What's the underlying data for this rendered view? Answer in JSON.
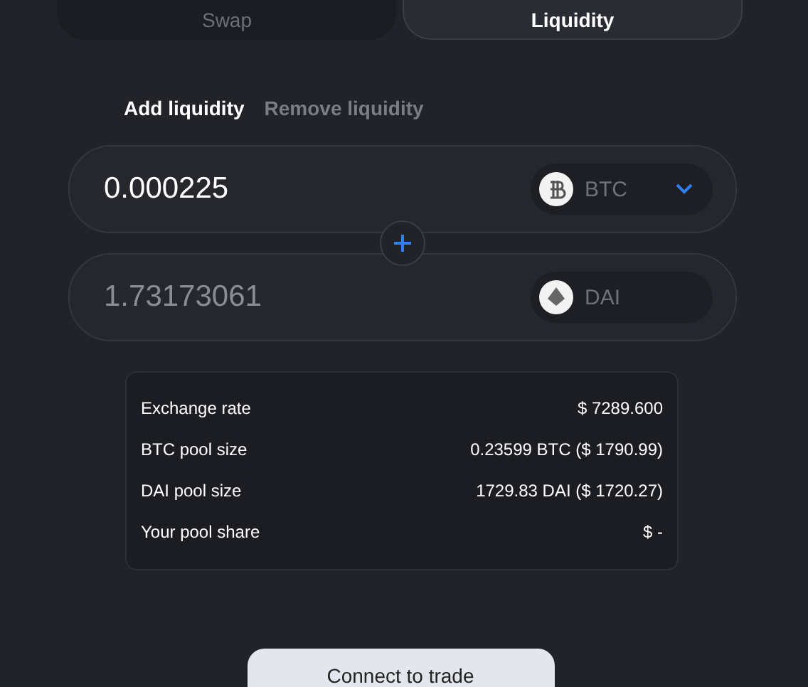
{
  "main_tabs": [
    {
      "label": "Swap",
      "selected": false
    },
    {
      "label": "Liquidity",
      "selected": true
    }
  ],
  "sub_tabs": [
    {
      "label": "Add liquidity",
      "selected": true
    },
    {
      "label": "Remove liquidity",
      "selected": false
    }
  ],
  "amounts": [
    {
      "value": "0.000225",
      "muted": false,
      "token": "BTC",
      "kind": "coin",
      "dropdown": true
    },
    {
      "value": "1.73173061",
      "muted": true,
      "token": "DAI",
      "kind": "diamond",
      "dropdown": false
    }
  ],
  "info": [
    {
      "label": "Exchange rate",
      "value": "$ 7289.600"
    },
    {
      "label": "BTC pool size",
      "value": "0.23599 BTC ($ 1790.99)"
    },
    {
      "label": "DAI pool size",
      "value": "1729.83 DAI ($ 1720.27)"
    },
    {
      "label": "Your pool share",
      "value": "$ -"
    }
  ],
  "button": "Connect to trade"
}
